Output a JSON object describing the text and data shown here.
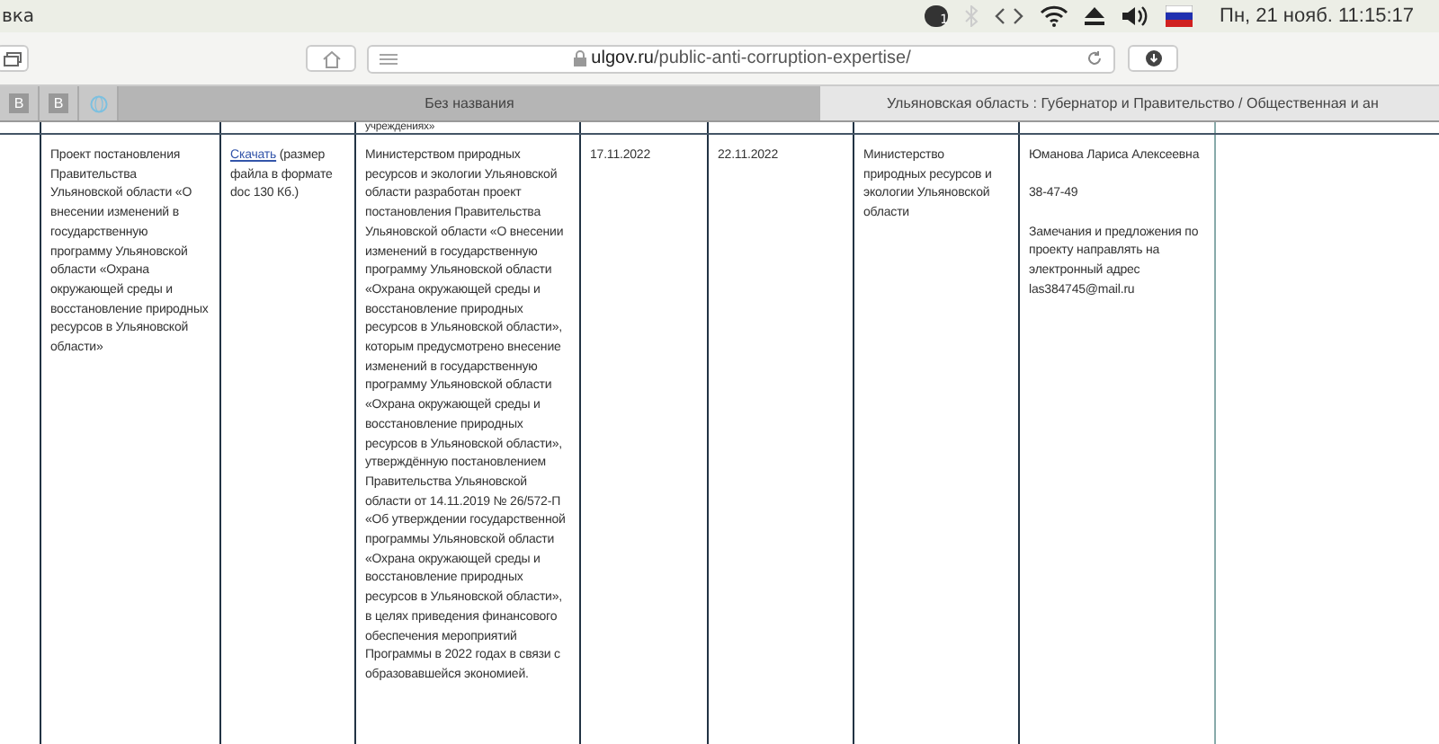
{
  "top_bar": {
    "app_title": "вка",
    "notification_count": "1",
    "clock": "Пн, 21 нояб. 11:15:17"
  },
  "browser": {
    "url_host": "ulgov.ru",
    "url_path": "/public-anti-corruption-expertise/"
  },
  "tabs": [
    {
      "kind": "pinned",
      "label": "В",
      "selected": false
    },
    {
      "kind": "pinned",
      "label": "В",
      "selected": false
    },
    {
      "kind": "globe",
      "selected": false
    },
    {
      "kind": "page",
      "label": "Без названия",
      "selected": true
    },
    {
      "kind": "page",
      "label": "Ульяновская область : Губернатор и Правительство / Общественная и ан",
      "selected": false
    }
  ],
  "table": {
    "previous_row_tail": "учреждениях»",
    "row": {
      "title": "Проект постановления Правительства Ульяновской области «О внесении изменений в государственную программу Ульяновской области «Охрана окружающей среды и восстановление природных ресурсов в Ульяновской области»",
      "download_link": "Скачать",
      "download_note": " (размер файла в формате doc 130 Кб.)",
      "description": "Министерством природных ресурсов и экологии Ульяновской области разработан проект постановления Правительства Ульяновской области «О внесении изменений  в государственную программу Ульяновской области «Охрана окружающей среды и восстановление природных ресурсов в Ульяновской области», которым предусмотрено внесение изменений в государственную программу Ульяновской области «Охрана окружающей среды и восстановление природных ресурсов в Ульяновской области», утверждённую постановлением Правительства Ульяновской области от 14.11.2019 № 26/572-П «Об утверждении государственной программы Ульяновской области «Охрана окружающей среды и восстановление природных ресурсов в Ульяновской области», в целях приведения финансового обеспечения мероприятий Программы  в 2022 годах в связи с образовавшейся экономией.",
      "start_date": "17.11.2022",
      "end_date": "22.11.2022",
      "developer": "Министерство природных ресурсов и экологии Ульяновской области",
      "contact_name": "Юманова Лариса Алексеевна",
      "contact_phone": "38-47-49",
      "contact_note": "Замечания и предложения по проекту направлять на электронный адрес las384745@mail.ru"
    }
  }
}
